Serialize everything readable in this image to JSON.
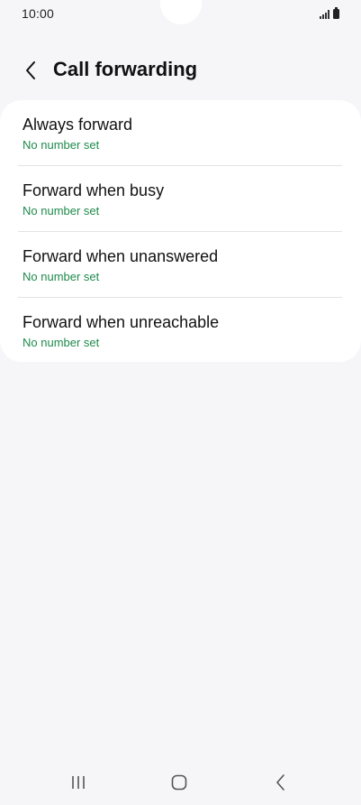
{
  "status_bar": {
    "time": "10:00"
  },
  "header": {
    "title": "Call forwarding",
    "back_icon": "chevron-left-icon"
  },
  "forwarding_options": [
    {
      "title": "Always forward",
      "subtitle": "No number set"
    },
    {
      "title": "Forward when busy",
      "subtitle": "No number set"
    },
    {
      "title": "Forward when unanswered",
      "subtitle": "No number set"
    },
    {
      "title": "Forward when unreachable",
      "subtitle": "No number set"
    }
  ],
  "nav_bar": {
    "recents_icon": "recent-apps-icon",
    "home_icon": "home-icon",
    "back_icon": "back-icon"
  },
  "colors": {
    "background": "#f6f6f8",
    "card": "#ffffff",
    "subtitle_accent": "#1f8a4c",
    "text": "#111111"
  }
}
